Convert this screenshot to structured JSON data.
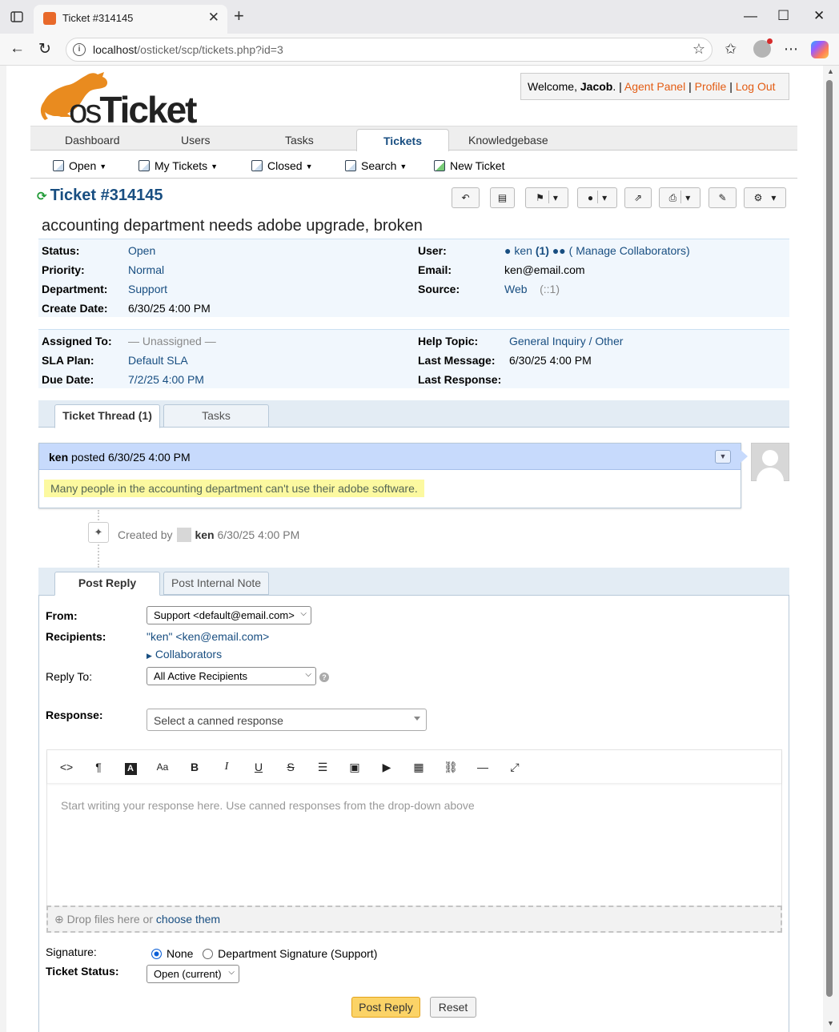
{
  "browser": {
    "tab_title": "Ticket #314145",
    "url_host": "localhost",
    "url_path": "/osticket/scp/tickets.php?id=3"
  },
  "header": {
    "logo_text_os": "os",
    "logo_text_ticket": "Ticket",
    "welcome_prefix": "Welcome, ",
    "user_name": "Jacob",
    "welcome_suffix": ". |",
    "agent_panel": "Agent Panel",
    "profile": "Profile",
    "logout": "Log Out",
    "sep": "|"
  },
  "main_nav": {
    "items": [
      "Dashboard",
      "Users",
      "Tasks",
      "Tickets",
      "Knowledgebase"
    ],
    "active": "Tickets"
  },
  "sub_nav": {
    "items": [
      "Open",
      "My Tickets",
      "Closed",
      "Search",
      "New Ticket"
    ]
  },
  "ticket": {
    "number": "Ticket #314145",
    "subject": "accounting department needs adobe upgrade, broken",
    "status_label": "Status:",
    "status": "Open",
    "priority_label": "Priority:",
    "priority": "Normal",
    "department_label": "Department:",
    "department": "Support",
    "create_date_label": "Create Date:",
    "create_date": "6/30/25 4:00 PM",
    "user_label": "User:",
    "user": "ken",
    "user_count": "(1)",
    "manage_collaborators": "( Manage Collaborators)",
    "email_label": "Email:",
    "email": "ken@email.com",
    "source_label": "Source:",
    "source": "Web",
    "source_ip": "(::1)",
    "assigned_label": "Assigned To:",
    "assigned": "— Unassigned —",
    "sla_label": "SLA Plan:",
    "sla": "Default SLA",
    "due_label": "Due Date:",
    "due": "7/2/25 4:00 PM",
    "help_topic_label": "Help Topic:",
    "help_topic": "General Inquiry / Other",
    "last_message_label": "Last Message:",
    "last_message": "6/30/25 4:00 PM",
    "last_response_label": "Last Response:",
    "last_response": ""
  },
  "thread_tabs": [
    "Ticket Thread (1)",
    "Tasks"
  ],
  "thread": {
    "author": "ken",
    "posted": " posted 6/30/25 4:00 PM",
    "body": "Many people in the accounting department can't use their adobe software.",
    "event_prefix": "Created by",
    "event_user": "ken",
    "event_time": "6/30/25 4:00 PM"
  },
  "reply_tabs": [
    "Post Reply",
    "Post Internal Note"
  ],
  "reply": {
    "from_label": "From:",
    "from_value": "Support <default@email.com>",
    "recipients_label": "Recipients:",
    "recipients_value": "\"ken\" <ken@email.com>",
    "collaborators": "Collaborators",
    "reply_to_label": "Reply To:",
    "reply_to_value": "All Active Recipients",
    "response_label": "Response:",
    "canned_placeholder": "Select a canned response",
    "editor_placeholder": "Start writing your response here. Use canned responses from the drop-down above",
    "drop_prefix": "Drop files here or ",
    "drop_link": "choose them",
    "signature_label": "Signature:",
    "sig_none": "None",
    "sig_dept": "Department Signature (Support)",
    "status_label": "Ticket Status:",
    "status_value": "Open (current)",
    "post_button": "Post Reply",
    "reset_button": "Reset"
  },
  "colors": {
    "link": "#184e81",
    "brand_orange": "#e35c13",
    "thread_header": "#c7dafc",
    "highlight": "#fcf9a0",
    "post_button": "#fbd367"
  }
}
